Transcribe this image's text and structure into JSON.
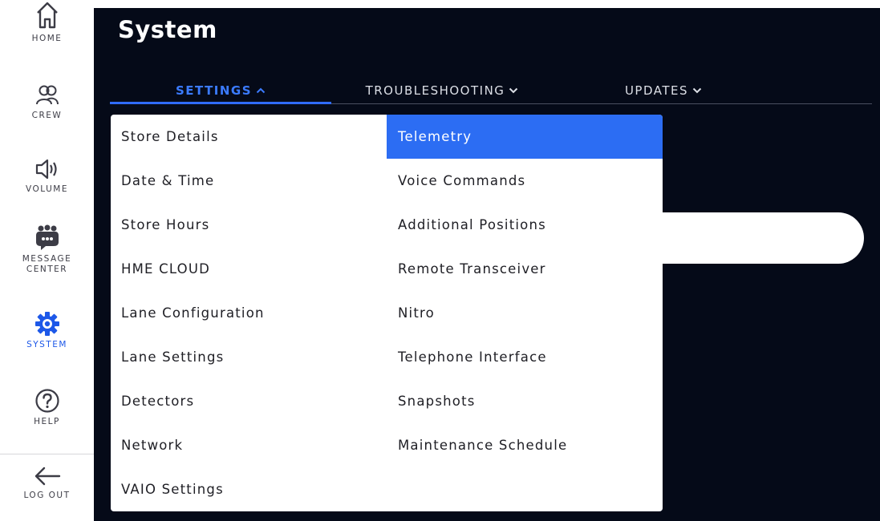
{
  "sidebar": {
    "items": [
      {
        "label": "HOME",
        "icon": "home-icon"
      },
      {
        "label": "CREW",
        "icon": "crew-icon"
      },
      {
        "label": "VOLUME",
        "icon": "volume-icon"
      },
      {
        "label_line1": "MESSAGE",
        "label_line2": "CENTER",
        "icon": "message-center-icon"
      },
      {
        "label": "SYSTEM",
        "icon": "gear-icon",
        "active": true
      },
      {
        "label": "HELP",
        "icon": "help-icon"
      },
      {
        "label": "LOG OUT",
        "icon": "arrow-left-icon"
      }
    ]
  },
  "page": {
    "title": "System"
  },
  "tabs": [
    {
      "label": "SETTINGS",
      "chevron": "chevron-up-icon",
      "active": true
    },
    {
      "label": "TROUBLESHOOTING",
      "chevron": "chevron-down-icon"
    },
    {
      "label": "UPDATES",
      "chevron": "chevron-down-icon"
    }
  ],
  "menu": {
    "left": [
      "Store Details",
      "Date & Time",
      "Store Hours",
      "HME CLOUD",
      "Lane Configuration",
      "Lane Settings",
      "Detectors",
      "Network",
      "VAIO Settings"
    ],
    "right": [
      "Telemetry",
      "Voice Commands",
      "Additional Positions",
      "Remote Transceiver",
      "Nitro",
      "Telephone Interface",
      "Snapshots",
      "Maintenance Schedule"
    ],
    "selected": "Telemetry"
  },
  "colors": {
    "accent": "#2c6df3",
    "background": "#050a18",
    "sidebar_text": "#3c3c46"
  }
}
